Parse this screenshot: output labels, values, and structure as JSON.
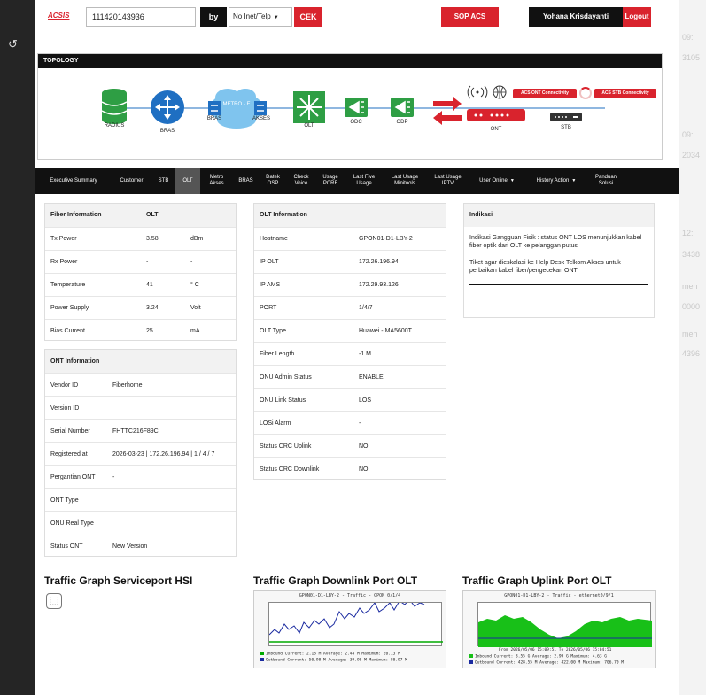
{
  "header": {
    "logo": "ACSIS",
    "search_value": "111420143936",
    "by_label": "by",
    "select_value": "No Inet/Telp",
    "cek_label": "CEK",
    "sop_label": "SOP ACS",
    "user_name": "Yohana Krisdayanti",
    "logout_label": "Logout"
  },
  "topology": {
    "title": "TOPOLOGY",
    "nodes": {
      "radius": "RADIUS",
      "bras": "BRAS",
      "bras2": "BRAS",
      "metro": "METRO - E",
      "akses": "AKSES",
      "olt": "OLT",
      "odc": "ODC",
      "odp": "ODP",
      "ont": "ONT",
      "stb": "STB"
    },
    "acs_ont": "ACS ONT Connectivity",
    "acs_stb": "ACS STB Connectivity",
    "colors": {
      "node_green": "#2e9e44",
      "node_blue": "#1f6fc2",
      "metro": "#5fb4e6",
      "arrow_red": "#d9232d"
    }
  },
  "tabs": [
    {
      "label": "Executive Summary"
    },
    {
      "label": "Customer"
    },
    {
      "label": "STB"
    },
    {
      "label": "OLT",
      "active": true
    },
    {
      "label": "Metro\nAkses"
    },
    {
      "label": "BRAS"
    },
    {
      "label": "Datek\nOSP"
    },
    {
      "label": "Check\nVoice"
    },
    {
      "label": "Usage\nPCRF"
    },
    {
      "label": "Last Five\nUsage"
    },
    {
      "label": "Last Usage\nMinitools"
    },
    {
      "label": "Last Usage\nIPTV"
    },
    {
      "label": "User Online",
      "dropdown": true
    },
    {
      "label": "History Action",
      "dropdown": true
    },
    {
      "label": "Panduan\nSolusi"
    }
  ],
  "fiber": {
    "header": [
      "Fiber Information",
      "OLT",
      ""
    ],
    "rows": [
      [
        "Tx Power",
        "3.58",
        "dBm"
      ],
      [
        "Rx Power",
        "-",
        "-"
      ],
      [
        "Temperature",
        "41",
        "° C"
      ],
      [
        "Power Supply",
        "3.24",
        "Volt"
      ],
      [
        "Bias Current",
        "25",
        "mA"
      ]
    ]
  },
  "ont": {
    "header": "ONT Information",
    "rows": [
      [
        "Vendor ID",
        "Fiberhome"
      ],
      [
        "Version ID",
        ""
      ],
      [
        "Serial Number",
        "FHTTC216F89C"
      ],
      [
        "Registered at",
        "2026-03-23 | 172.26.196.94 | 1 / 4 / 7"
      ],
      [
        "Pergantian ONT",
        "-"
      ],
      [
        "ONT Type",
        ""
      ],
      [
        "ONU Real Type",
        ""
      ],
      [
        "Status ONT",
        "New Version"
      ]
    ]
  },
  "olt": {
    "header": "OLT Information",
    "rows": [
      [
        "Hostname",
        "GPON01-D1-LBY-2"
      ],
      [
        "IP OLT",
        "172.26.196.94"
      ],
      [
        "IP AMS",
        "172.29.93.126"
      ],
      [
        "PORT",
        "1/4/7"
      ],
      [
        "OLT Type",
        "Huawei - MA5600T"
      ],
      [
        "Fiber Length",
        "-1 M"
      ],
      [
        "ONU Admin Status",
        "ENABLE"
      ],
      [
        "ONU Link Status",
        "LOS"
      ],
      [
        "LOSi Alarm",
        "-"
      ],
      [
        "Status CRC Uplink",
        "NO"
      ],
      [
        "Status CRC Downlink",
        "NO"
      ]
    ]
  },
  "indikasi": {
    "header": "Indikasi",
    "p1": "Indikasi Gangguan Fisik : status ONT LOS menunjukkan kabel fiber optik dari OLT ke pelanggan putus",
    "p2": "Tiket agar dieskalasi ke Help Desk Telkom Akses untuk perbaikan kabel fiber/pengecekan ONT"
  },
  "traffic": {
    "hsi_title": "Traffic Graph Serviceport HSI",
    "down_title": "Traffic Graph Downlink Port OLT",
    "up_title": "Traffic Graph Uplink Port OLT",
    "down_graph_title": "GPON01-D1-LBY-2 - Traffic - GPON 0/1/4",
    "down_leg1": "Inbound  Current:  2.18 M  Average:  2.44 M  Maximum:  20.13 M",
    "down_leg2": "Outbound Current: 50.98 M  Average: 39.98 M  Maximum:  80.97 M",
    "up_graph_title": "GPON01-D1-LBY-2 - Traffic - ethernet0/9/1",
    "up_sub": "From 2026/05/06 15:09:51 To 2026/05/06 15:04:51",
    "up_leg1": "Inbound  Current:  3.55 G  Average:  2.99 G  Maximum:  4.63 G",
    "up_leg2": "Outbound Current: 428.55 M  Average: 422.00 M  Maximum: 706.70 M"
  },
  "bleed": [
    "09:",
    "3105",
    "09:",
    "2034",
    "12:",
    "3438",
    "men",
    "0000",
    "men",
    "4396"
  ]
}
